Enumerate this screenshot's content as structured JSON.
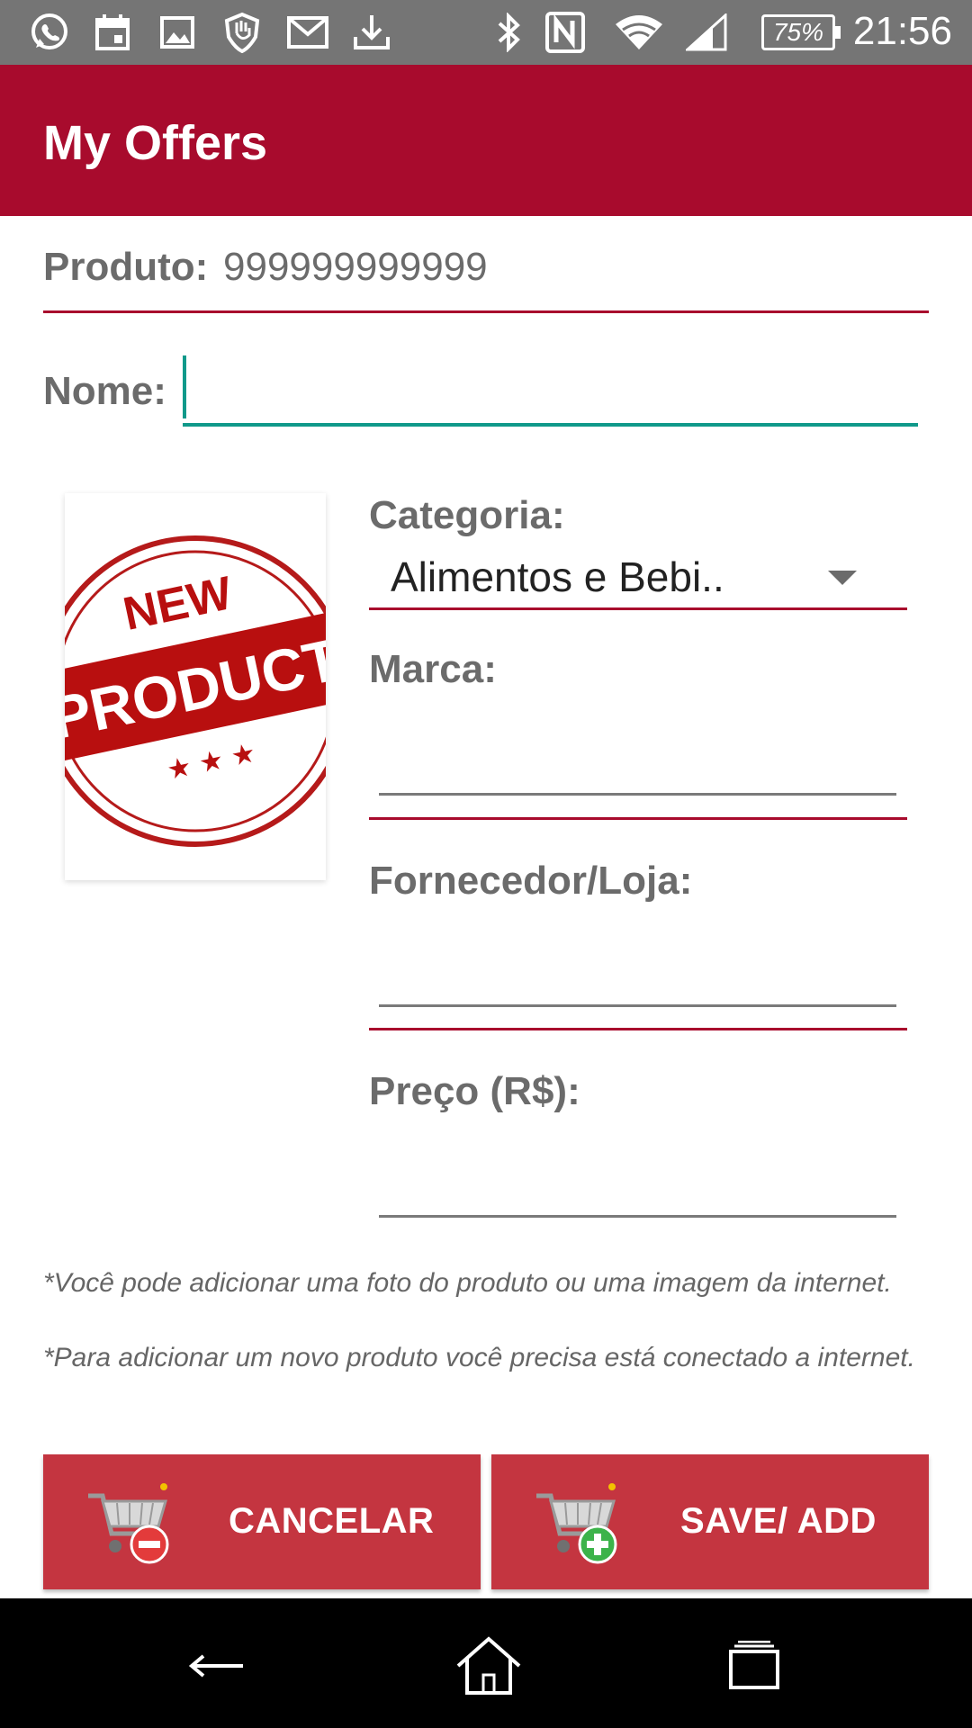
{
  "status_bar": {
    "time": "21:56",
    "battery": "75%",
    "left_icons": [
      "whatsapp-icon",
      "calendar-icon",
      "image-icon",
      "shield-hand-icon",
      "gmail-icon",
      "download-icon"
    ],
    "right_icons": [
      "bluetooth-icon",
      "nfc-icon",
      "wifi-icon",
      "signal-icon"
    ]
  },
  "app_bar": {
    "title": "My Offers",
    "color": "#a80b2d"
  },
  "form": {
    "produto_label": "Produto:",
    "produto_value": "999999999999",
    "nome_label": "Nome:",
    "nome_value": "",
    "categoria_label": "Categoria:",
    "categoria_value": "Alimentos e Bebi..",
    "marca_label": "Marca:",
    "marca_value": "",
    "fornecedor_label": "Fornecedor/Loja:",
    "fornecedor_value": "",
    "preco_label": "Preço (R$):",
    "preco_value": ""
  },
  "product_image": {
    "stamp_top": "NEW",
    "stamp_main": "PRODUCT",
    "stamp_stars": "★ ★ ★"
  },
  "notes": {
    "note1": "*Você pode adicionar uma foto do produto ou uma imagem da internet.",
    "note2": "*Para adicionar um novo produto você precisa está conectado a internet."
  },
  "buttons": {
    "cancel_label": "CANCELAR",
    "save_label": "SAVE/ ADD",
    "color": "#c43540"
  },
  "accent_colors": {
    "primary": "#a80b2d",
    "focus": "#10998a"
  }
}
